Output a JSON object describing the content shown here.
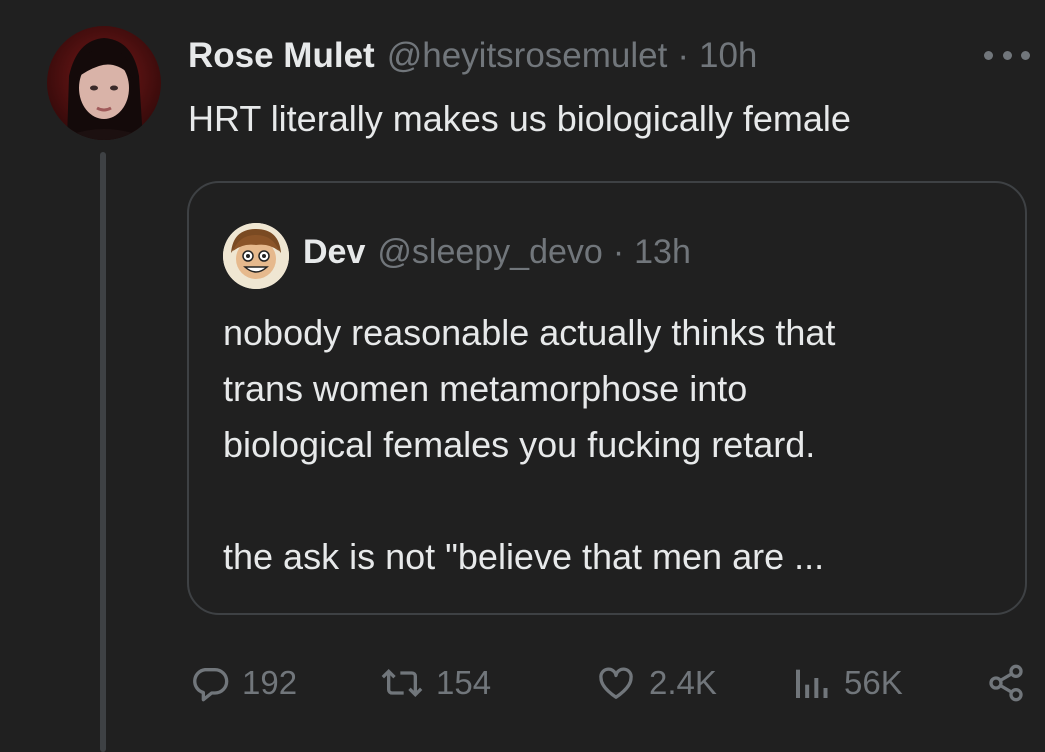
{
  "post": {
    "author_name": "Rose Mulet",
    "handle": "@heyitsrosemulet",
    "separator": "·",
    "time": "10h",
    "text": "HRT literally makes us biologically female"
  },
  "quoted": {
    "author_name": "Dev",
    "handle": "@sleepy_devo",
    "separator": "·",
    "time": "13h",
    "lines": [
      "nobody reasonable actually thinks that",
      "trans women metamorphose into",
      "biological females you fucking retard.",
      "the ask is not \"believe that men are ..."
    ]
  },
  "actions": {
    "replies": "192",
    "reposts": "154",
    "likes": "2.4K",
    "views": "56K"
  },
  "icons": {
    "more": "more-horizontal-icon",
    "reply": "reply-bubble-icon",
    "repost": "repost-arrows-icon",
    "like": "heart-icon",
    "views": "bar-chart-icon",
    "share": "share-nodes-icon"
  },
  "colors": {
    "background": "#202020",
    "text": "#e7e9ea",
    "muted": "#71767b",
    "border": "#3e4144"
  }
}
